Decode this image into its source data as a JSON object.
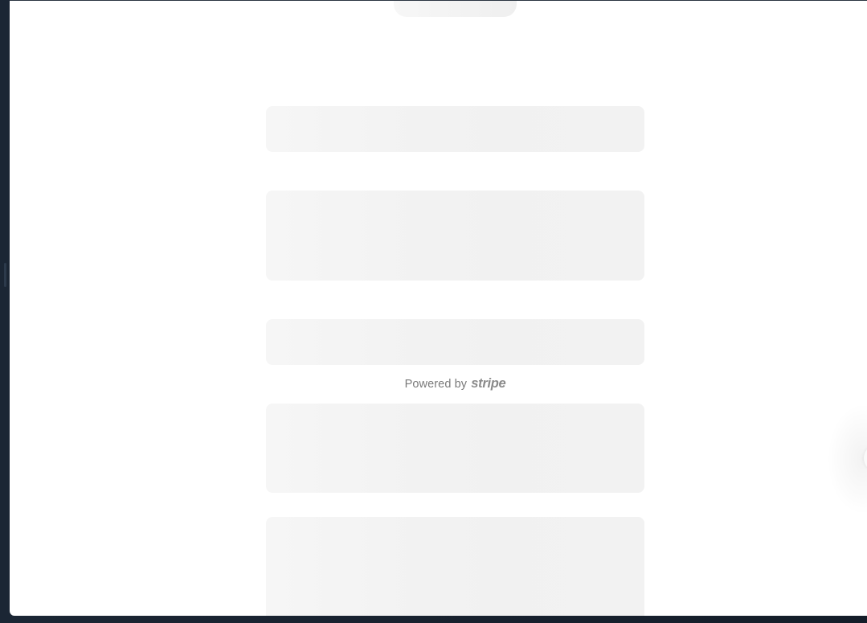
{
  "footer": {
    "powered_by_label": "Powered by",
    "brand_name": "stripe"
  },
  "colors": {
    "backdrop": "#15202e",
    "sheet": "#ffffff",
    "skeleton": "#f3f3f3",
    "footer_text": "#7a7a7a"
  }
}
